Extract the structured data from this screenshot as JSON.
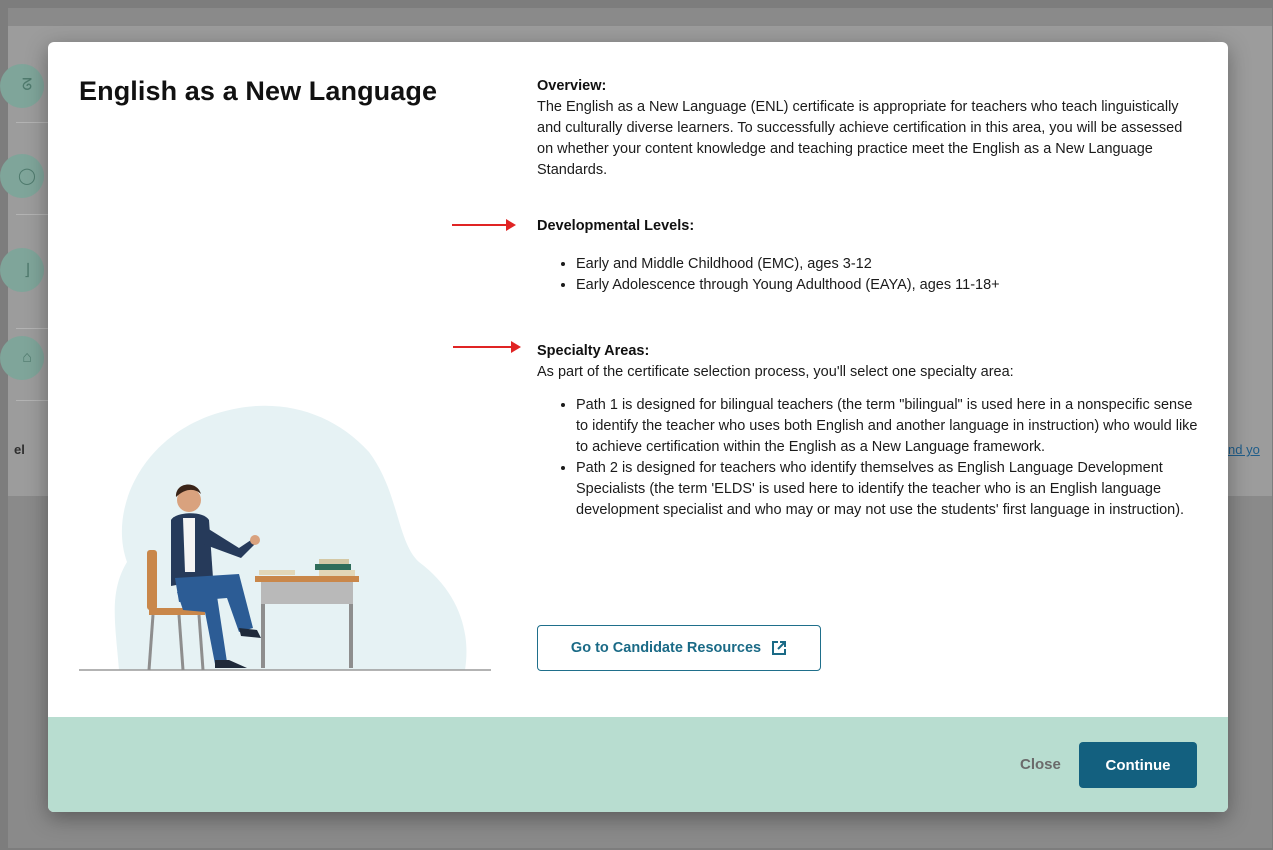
{
  "modal": {
    "title": "English as a New Language",
    "overview_heading": "Overview:",
    "overview_text": "The English as a New Language (ENL) certificate is appropriate for teachers who teach linguistically and culturally diverse learners. To successfully achieve certification in this area, you will be assessed on whether your content knowledge and teaching practice meet the English as a New Language Standards.",
    "developmental_heading": "Developmental Levels:",
    "developmental_levels": [
      "Early and Middle Childhood (EMC), ages 3-12",
      "Early Adolescence through Young Adulthood (EAYA), ages 11-18+"
    ],
    "specialty_heading": "Specialty Areas:",
    "specialty_intro": "As part of the certificate selection process, you'll select one specialty area:",
    "specialty_paths": [
      "Path 1 is designed for bilingual teachers (the term \"bilingual\" is used here in a nonspecific sense to identify the teacher who uses both English and another language in instruction) who would like to achieve certification within the English as a New Language framework.",
      "Path 2 is designed for teachers who identify themselves as English Language Development Specialists (the term 'ELDS' is used here to identify the teacher who is an English language development specialist and who may or may not use the students' first language in instruction)."
    ],
    "resources_button": "Go to Candidate Resources",
    "resources_icon": "external-link-icon",
    "close_label": "Close",
    "continue_label": "Continue"
  },
  "background": {
    "row_label_partial": "el",
    "link_partial": "nd yo"
  },
  "colors": {
    "primary": "#13607f",
    "footer": "#b8ddd0",
    "annotation_arrow": "#e02424"
  }
}
